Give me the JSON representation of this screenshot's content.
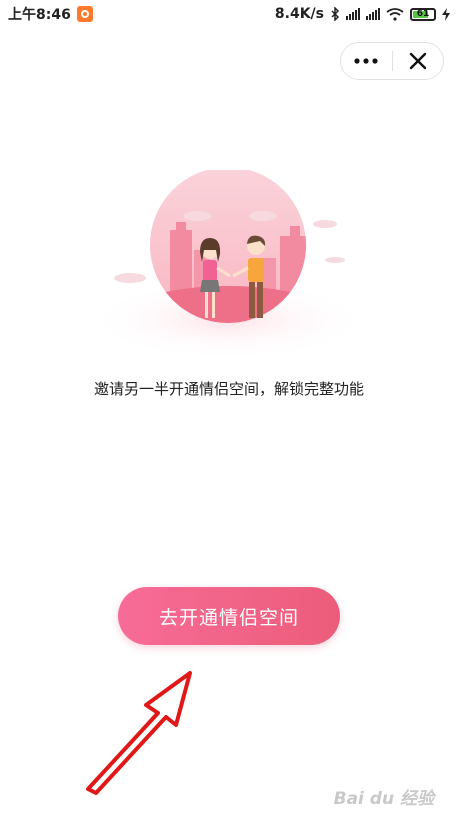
{
  "status_bar": {
    "time": "上午8:46",
    "net_speed": "8.4K/s",
    "battery": "61"
  },
  "capsule": {
    "more_icon": "ellipsis-icon",
    "close_icon": "close-icon"
  },
  "caption": "邀请另一半开通情侣空间，解锁完整功能",
  "cta_label": "去开通情侣空间",
  "colors": {
    "accent": "#ec5c7a",
    "accent_light": "#f76c97"
  }
}
